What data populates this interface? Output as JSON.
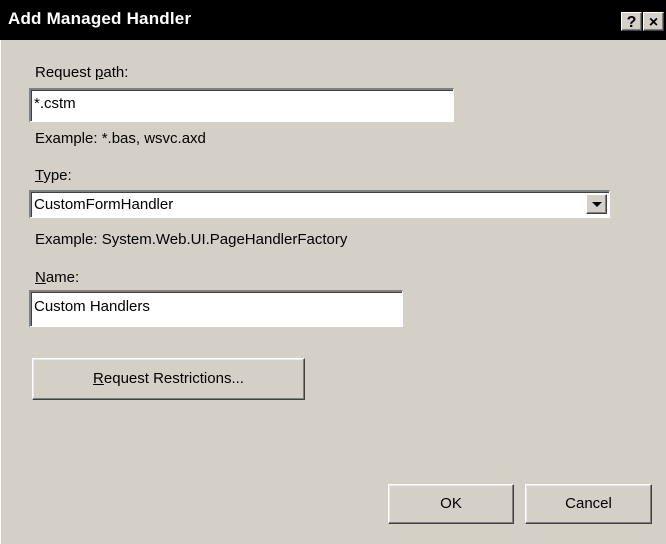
{
  "window": {
    "title": "Add Managed Handler",
    "help_glyph": "?",
    "close_glyph": "×"
  },
  "request_path": {
    "label_prefix": "Request ",
    "label_accel": "p",
    "label_suffix": "ath:",
    "value": "*.cstm",
    "example": "Example: *.bas, wsvc.axd"
  },
  "type": {
    "label_accel": "T",
    "label_suffix": "ype:",
    "selected": "CustomFormHandler",
    "example": "Example: System.Web.UI.PageHandlerFactory"
  },
  "name": {
    "label_accel": "N",
    "label_suffix": "ame:",
    "value": "Custom Handlers"
  },
  "buttons": {
    "restrictions_accel": "R",
    "restrictions_rest": "equest Restrictions...",
    "ok": "OK",
    "cancel": "Cancel"
  }
}
